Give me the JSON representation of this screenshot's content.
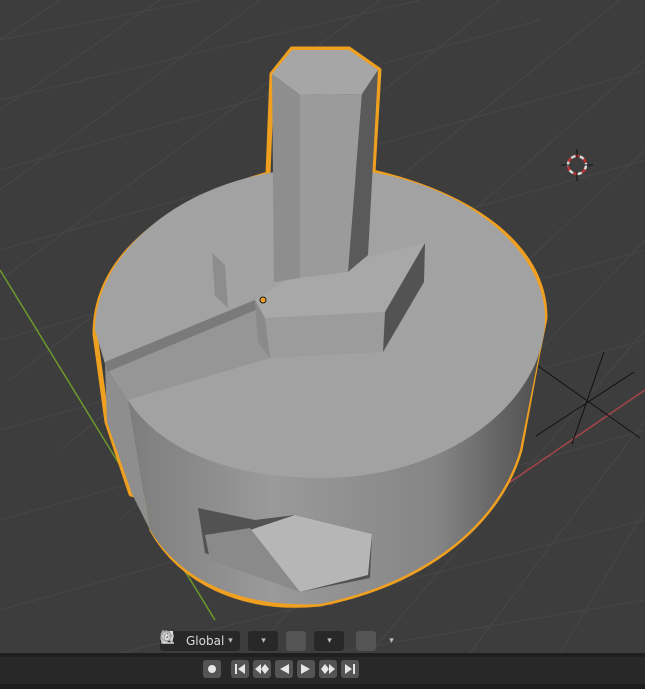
{
  "header": {
    "transform_orientation": {
      "value": "Global",
      "options": [
        "Global"
      ]
    },
    "icons": [
      "transform-orientation-icon",
      "pivot-point-icon",
      "snap-icon",
      "snap-target-icon",
      "proportional-editing-icon",
      "falloff-icon"
    ]
  },
  "timeline": {
    "controls": [
      "record-button",
      "jump-to-start-button",
      "jump-to-previous-keyframe-button",
      "play-reverse-button",
      "play-button",
      "jump-to-next-keyframe-button",
      "jump-to-end-button"
    ]
  },
  "colors": {
    "viewport_bg": "#3d3d3d",
    "grid": "#474747",
    "x_axis": "#a8454a",
    "y_axis": "#6e9a2b",
    "selection_outline": "#f0a020",
    "mesh_light": "#a3a3a3",
    "mesh_dark": "#545454",
    "header_bg": "#282828"
  }
}
